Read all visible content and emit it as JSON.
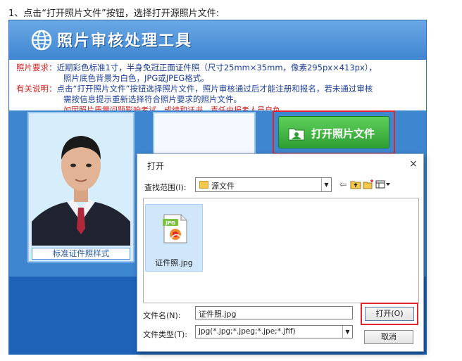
{
  "caption": "1、点击“打开照片文件”按钮，选择打开源照片文件:",
  "app": {
    "title": "照片审核处理工具",
    "logo_icon": "globe-icon",
    "notice": {
      "req_label": "照片要求：",
      "req_line1": "近期彩色标准1寸，半身免冠正面证件照（尺寸25mm×35mm，像素295px×413px），",
      "req_line2": "照片底色背景为白色，JPG或JPEG格式。",
      "info_label": "有关说明：",
      "info_line1": "点击“打开照片文件”按钮选择照片文件，照片审核通过后才能注册和报名，若未通过审核",
      "info_line2": "需按信息提示重新选择符合照片要求的照片文件。",
      "info_line3": "如因照片质量问题影响考试、成绩和证书，责任由报考人员自负。"
    },
    "sample_caption": "标准证件照样式",
    "open_photo_button": "打开照片文件",
    "colors": {
      "header": "#3f86d0",
      "red": "#d21f1f",
      "blue": "#1c3f9c",
      "green": "#2f9f33"
    }
  },
  "dialog": {
    "title": "打开",
    "close_glyph": "×",
    "look_in_label": "查找范围(I):",
    "look_in_value": "源文件",
    "toolbar_icons": [
      "back-arrow-icon",
      "up-folder-icon",
      "new-folder-icon",
      "view-menu-icon"
    ],
    "files": [
      {
        "name": "证件照.jpg",
        "icon": "jpg-file-icon"
      }
    ],
    "file_name_label": "文件名(N):",
    "file_name_value": "证件照.jpg",
    "file_type_label": "文件类型(T):",
    "file_type_value": "jpg(*.jpg;*.jpeg;*.jpe;*.jfif)",
    "open_button": "打开(O)",
    "cancel_button": "取消"
  }
}
